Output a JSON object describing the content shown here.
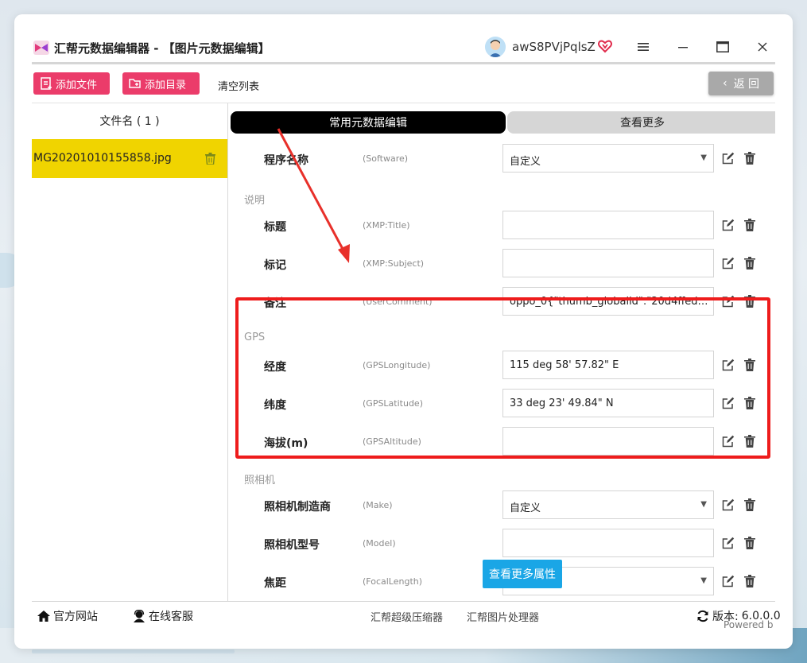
{
  "window": {
    "title": "汇帮元数据编辑器 - 【图片元数据编辑】",
    "username": "awS8PVjPqlsZ"
  },
  "toolbar": {
    "add_file": "添加文件",
    "add_dir": "添加目录",
    "clear_list": "清空列表",
    "back": "返 回"
  },
  "file_list": {
    "header": "文件名 ( 1 )",
    "items": [
      {
        "name": "MG20201010155858.jpg"
      }
    ]
  },
  "tabs": {
    "common": "常用元数据编辑",
    "more": "查看更多"
  },
  "sections": {
    "description": "说明",
    "gps": "GPS",
    "camera": "照相机"
  },
  "fields": [
    {
      "label": "程序名称",
      "key": "(Software)",
      "value": "自定义",
      "type": "select"
    },
    {
      "label": "标题",
      "key": "(XMP:Title)",
      "value": "",
      "type": "text"
    },
    {
      "label": "标记",
      "key": "(XMP:Subject)",
      "value": "",
      "type": "text"
    },
    {
      "label": "备注",
      "key": "(UserComment)",
      "value": "oppo_0{\"thumb_globalid\":\"20d4ffedac...",
      "type": "text"
    },
    {
      "label": "经度",
      "key": "(GPSLongitude)",
      "value": "115 deg 58' 57.82\" E",
      "type": "text"
    },
    {
      "label": "纬度",
      "key": "(GPSLatitude)",
      "value": "33 deg 23' 49.84\" N",
      "type": "text"
    },
    {
      "label": "海拔(m)",
      "key": "(GPSAltitude)",
      "value": "",
      "type": "text"
    },
    {
      "label": "照相机制造商",
      "key": "(Make)",
      "value": "自定义",
      "type": "select"
    },
    {
      "label": "照相机型号",
      "key": "(Model)",
      "value": "",
      "type": "text"
    },
    {
      "label": "焦距",
      "key": "(FocalLength)",
      "value": "",
      "type": "select"
    }
  ],
  "more_properties_btn": "查看更多属性",
  "footer": {
    "website": "官方网站",
    "support": "在线客服",
    "compressor": "汇帮超级压缩器",
    "image_processor": "汇帮图片处理器",
    "version_label": "版本:",
    "version": "6.0.0.0"
  },
  "powered": "Powered b",
  "colors": {
    "accent_pink": "#eb3c6a",
    "selected_yellow": "#f0d400",
    "highlight_red": "#ee1c1c",
    "button_blue": "#1aa6e6"
  }
}
